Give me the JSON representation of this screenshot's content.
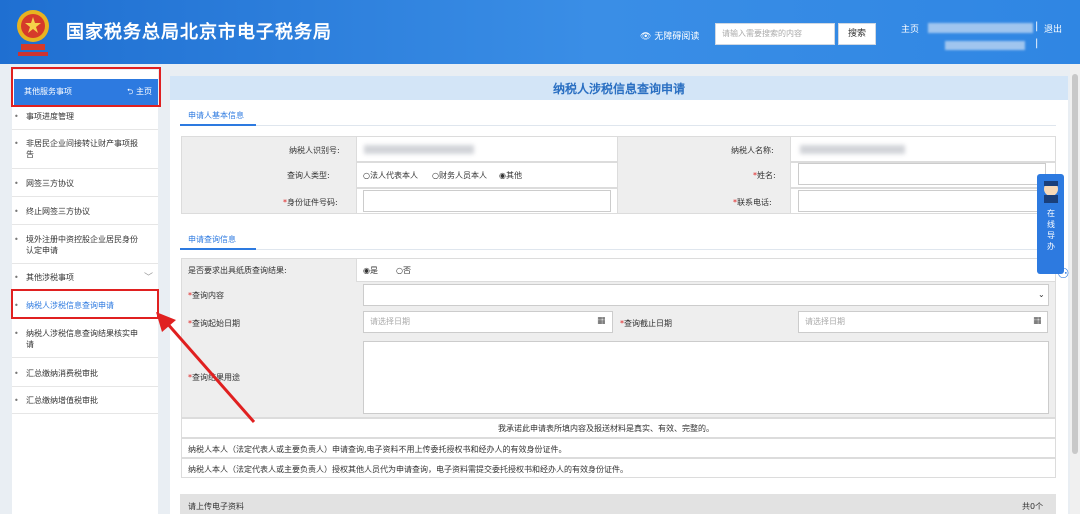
{
  "header": {
    "title": "国家税务总局北京市电子税务局",
    "accessibility": "无障碍阅读",
    "search_placeholder": "请输入需要搜索的内容",
    "search_button": "搜索",
    "home": "主页",
    "logout": "退出",
    "separator": "|"
  },
  "sidebar": {
    "header": "其他服务事项",
    "home_link": "主页",
    "items": [
      {
        "label": "事项进度管理"
      },
      {
        "label": "非居民企业间接转让财产事项报告"
      },
      {
        "label": "网签三方协议"
      },
      {
        "label": "终止网签三方协议"
      },
      {
        "label": "境外注册中资控股企业居民身份认定申请"
      },
      {
        "label": "其他涉税事项"
      },
      {
        "label": "纳税人涉税信息查询申请"
      },
      {
        "label": "纳税人涉税信息查询结果核实申请"
      },
      {
        "label": "汇总缴纳消费税审批"
      },
      {
        "label": "汇总缴纳增值税审批"
      }
    ],
    "active_index": 6
  },
  "main": {
    "title": "纳税人涉税信息查询申请",
    "basic_section": "申请人基本信息",
    "taxpayer_id_label": "纳税人识别号:",
    "taxpayer_name_label": "纳税人名称:",
    "querier_type_label": "查询人类型:",
    "querier_options": [
      "○法人代表本人",
      "○财务人员本人",
      "◉其他"
    ],
    "name_label": "姓名:",
    "id_no_label": "身份证件号码:",
    "phone_label": "联系电话:",
    "query_section": "申请查询信息",
    "paper_label": "是否要求出具纸质查询结果:",
    "paper_yes": "◉是",
    "paper_no": "○否",
    "content_label": "查询内容",
    "start_label": "查询起始日期",
    "end_label": "查询截止日期",
    "date_placeholder": "请选择日期",
    "purpose_label": "查询结果用途",
    "commitment": "我承诺此申请表所填内容及报送材料是真实、有效、完整的。",
    "note1": "纳税人本人（法定代表人或主要负责人）申请查询,电子资料不用上传委托授权书和经办人的有效身份证件。",
    "note2": "纳税人本人（法定代表人或主要负责人）授权其他人员代为申请查询，电子资料需提交委托授权书和经办人的有效身份证件。",
    "upload_label": "请上传电子资料",
    "upload_count": "共0个",
    "required_mark": "*"
  },
  "help_widget": {
    "label": "在线导办"
  },
  "colors": {
    "primary": "#2d7ae0",
    "header": "#1f6fd1",
    "highlight": "#e02020"
  }
}
